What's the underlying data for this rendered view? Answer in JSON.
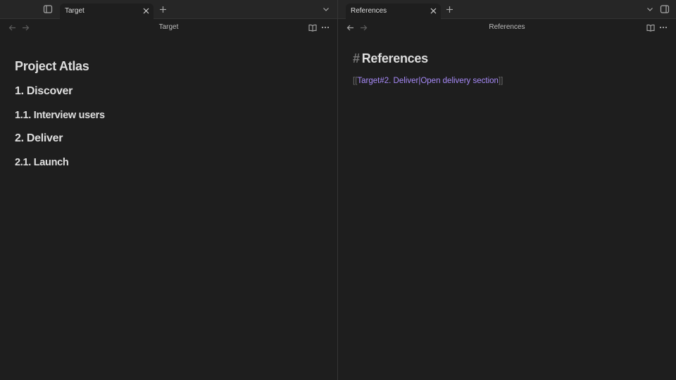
{
  "left_pane": {
    "tab_title": "Target",
    "nav_title": "Target",
    "headings": [
      {
        "level": 1,
        "text": "Project Atlas"
      },
      {
        "level": 2,
        "text": "1. Discover"
      },
      {
        "level": 3,
        "text": "1.1. Interview users"
      },
      {
        "level": 2,
        "text": "2. Deliver"
      },
      {
        "level": 3,
        "text": "2.1. Launch"
      }
    ]
  },
  "right_pane": {
    "tab_title": "References",
    "nav_title": "References",
    "heading_hash": "#",
    "heading": "References",
    "link_open": "[[",
    "link_target": "Target#2. Deliver",
    "link_pipe": "|",
    "link_alias": "Open delivery section",
    "link_close": "]]"
  },
  "icons": {
    "left_tabbar": [
      "sidebar-toggle-icon",
      "close-icon",
      "plus-icon",
      "chevron-down-icon"
    ],
    "right_tabbar": [
      "close-icon",
      "plus-icon",
      "chevron-down-icon",
      "right-sidebar-toggle-icon"
    ],
    "navbar": [
      "arrow-left-icon",
      "arrow-right-icon",
      "book-open-icon",
      "more-horizontal-icon"
    ]
  },
  "colors": {
    "background": "#1e1e1e",
    "tabbar": "#262626",
    "link": "#a88bfa",
    "text": "#dedede"
  }
}
